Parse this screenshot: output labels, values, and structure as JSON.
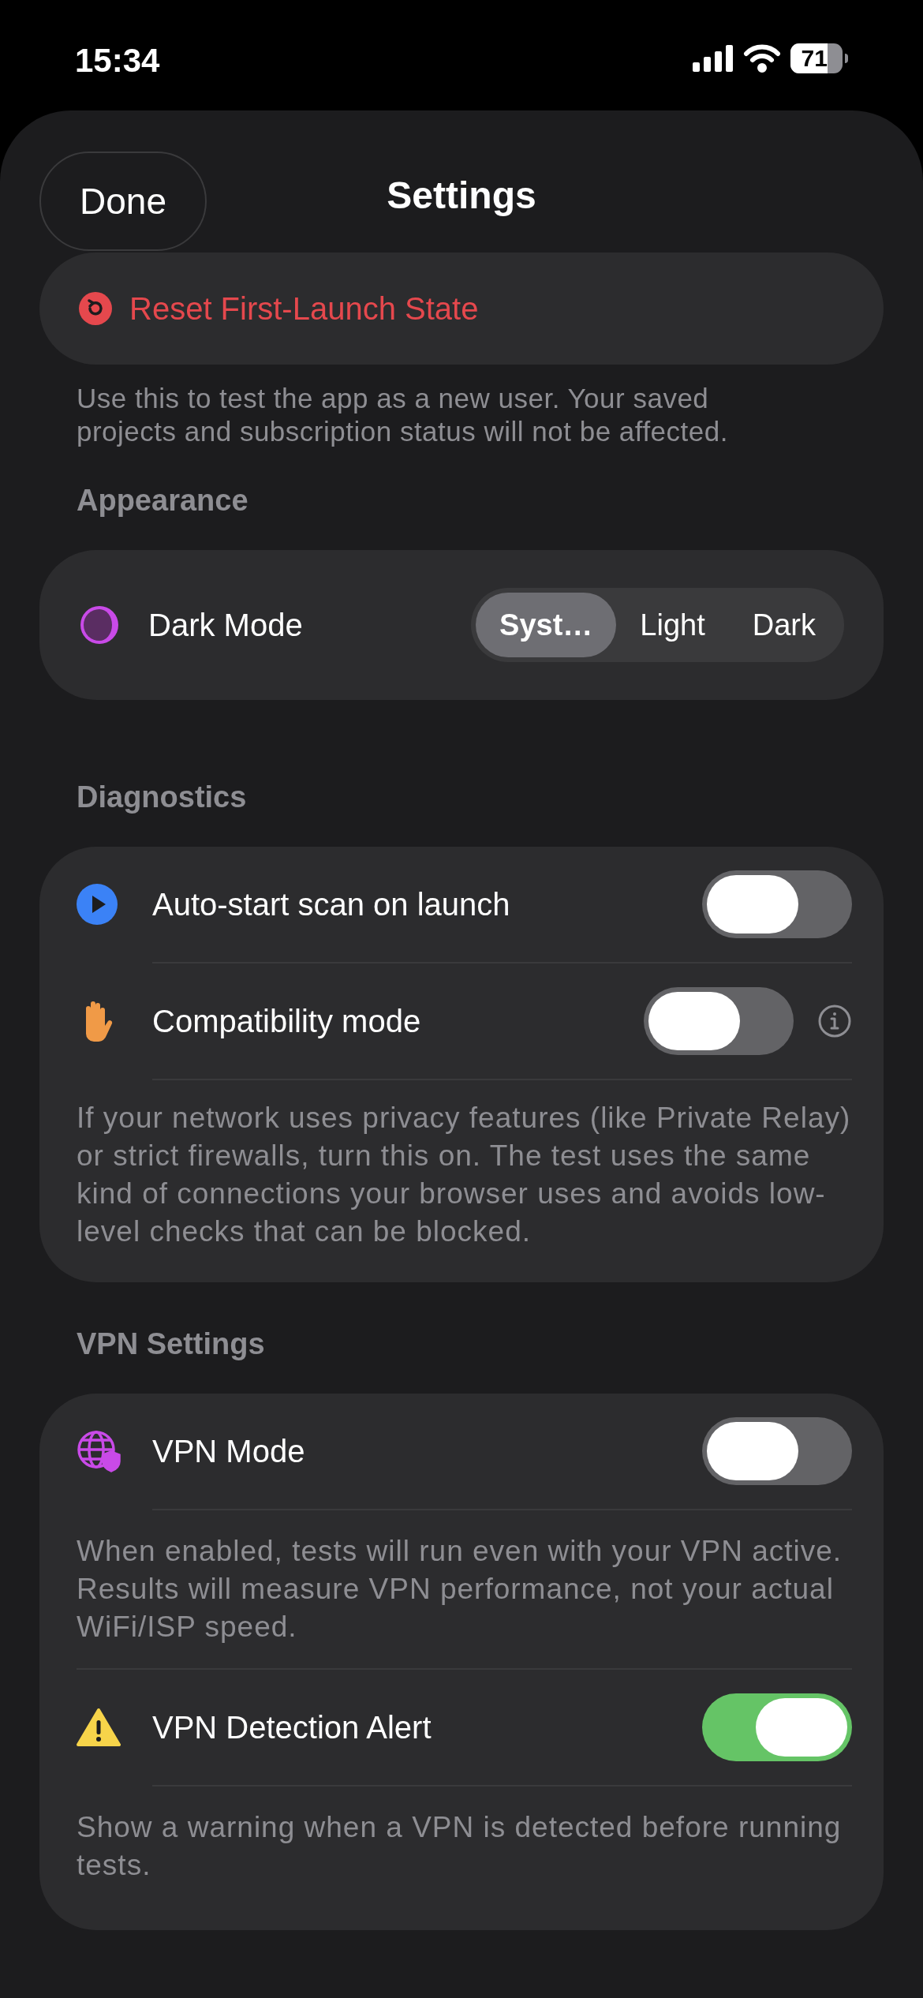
{
  "status_bar": {
    "time": "15:34",
    "battery": "71"
  },
  "nav": {
    "done": "Done",
    "title": "Settings"
  },
  "reset": {
    "label": "Reset First-Launch State",
    "footer": "Use this to test the app as a new user. Your saved projects and subscription status will not be affected."
  },
  "appearance": {
    "header": "Appearance",
    "label": "Dark Mode",
    "options": [
      {
        "label": "Syst…",
        "selected": true
      },
      {
        "label": "Light",
        "selected": false
      },
      {
        "label": "Dark",
        "selected": false
      }
    ]
  },
  "diagnostics": {
    "header": "Diagnostics",
    "rows": [
      {
        "kind": "play",
        "label": "Auto-start scan on launch",
        "on": false,
        "info": false
      },
      {
        "kind": "hand",
        "label": "Compatibility mode",
        "on": false,
        "info": true
      }
    ],
    "footer": "If your network uses privacy features (like Private Relay) or strict firewalls, turn this on. The test uses the same kind of connections your browser uses and avoids low-level checks that can be blocked."
  },
  "vpn": {
    "header": "VPN Settings",
    "rows": [
      {
        "kind": "globe",
        "label": "VPN Mode",
        "on": false,
        "note": "When enabled, tests will run even with your VPN active. Results will measure VPN performance, not your actual WiFi/ISP speed."
      },
      {
        "kind": "warning",
        "label": "VPN Detection Alert",
        "on": true,
        "note": "Show a warning when a VPN is detected before running tests."
      }
    ]
  }
}
